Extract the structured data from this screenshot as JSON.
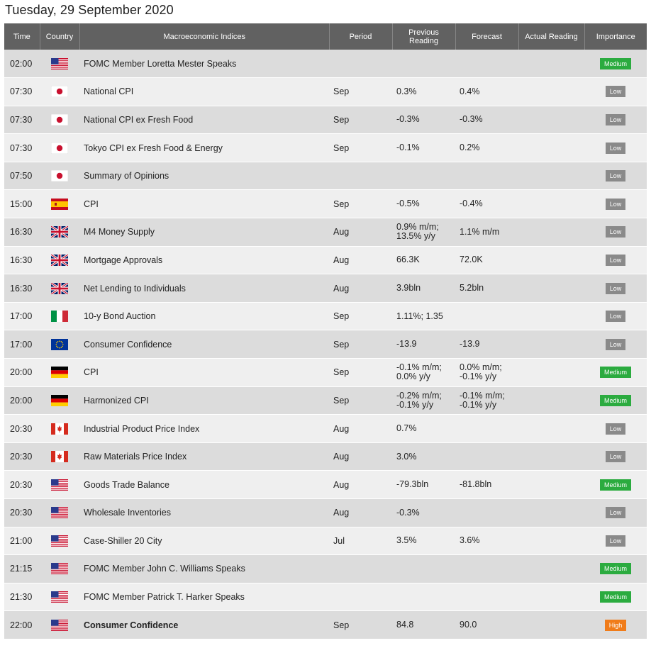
{
  "page": {
    "title": "Tuesday, 29 September 2020"
  },
  "table": {
    "headers": {
      "time": "Time",
      "country": "Country",
      "indices": "Macroeconomic Indices",
      "period": "Period",
      "previous_line1": "Previous",
      "previous_line2": "Reading",
      "forecast": "Forecast",
      "actual": "Actual Reading",
      "importance": "Importance"
    },
    "colors": {
      "Medium": "#2bab3f",
      "Low": "#8a8a8a",
      "High": "#f07c1a"
    },
    "rows": [
      {
        "time": "02:00",
        "flag": "us-flag-icon",
        "event": "FOMC Member Loretta Mester Speaks",
        "period": "",
        "prev1": "",
        "prev2": "",
        "fore1": "",
        "fore2": "",
        "actual": "",
        "importance": "Medium",
        "bold": false
      },
      {
        "time": "07:30",
        "flag": "jp-flag-icon",
        "event": "National CPI",
        "period": "Sep",
        "prev1": "0.3%",
        "prev2": "",
        "fore1": "0.4%",
        "fore2": "",
        "actual": "",
        "importance": "Low",
        "bold": false
      },
      {
        "time": "07:30",
        "flag": "jp-flag-icon",
        "event": "National CPI ex Fresh Food",
        "period": "Sep",
        "prev1": "-0.3%",
        "prev2": "",
        "fore1": "-0.3%",
        "fore2": "",
        "actual": "",
        "importance": "Low",
        "bold": false
      },
      {
        "time": "07:30",
        "flag": "jp-flag-icon",
        "event": "Tokyo CPI ex Fresh Food & Energy",
        "period": "Sep",
        "prev1": "-0.1%",
        "prev2": "",
        "fore1": "0.2%",
        "fore2": "",
        "actual": "",
        "importance": "Low",
        "bold": false
      },
      {
        "time": "07:50",
        "flag": "jp-flag-icon",
        "event": "Summary of Opinions",
        "period": "",
        "prev1": "",
        "prev2": "",
        "fore1": "",
        "fore2": "",
        "actual": "",
        "importance": "Low",
        "bold": false
      },
      {
        "time": "15:00",
        "flag": "es-flag-icon",
        "event": "CPI",
        "period": "Sep",
        "prev1": "-0.5%",
        "prev2": "",
        "fore1": "-0.4%",
        "fore2": "",
        "actual": "",
        "importance": "Low",
        "bold": false
      },
      {
        "time": "16:30",
        "flag": "gb-flag-icon",
        "event": "M4 Money Supply",
        "period": "Aug",
        "prev1": "0.9% m/m;",
        "prev2": "13.5% y/y",
        "fore1": "1.1% m/m",
        "fore2": "",
        "actual": "",
        "importance": "Low",
        "bold": false
      },
      {
        "time": "16:30",
        "flag": "gb-flag-icon",
        "event": "Mortgage Approvals",
        "period": "Aug",
        "prev1": "66.3K",
        "prev2": "",
        "fore1": "72.0K",
        "fore2": "",
        "actual": "",
        "importance": "Low",
        "bold": false
      },
      {
        "time": "16:30",
        "flag": "gb-flag-icon",
        "event": "Net Lending to Individuals",
        "period": "Aug",
        "prev1": "3.9bln",
        "prev2": "",
        "fore1": "5.2bln",
        "fore2": "",
        "actual": "",
        "importance": "Low",
        "bold": false
      },
      {
        "time": "17:00",
        "flag": "it-flag-icon",
        "event": "10-y Bond Auction",
        "period": "Sep",
        "prev1": "1.11%; 1.35",
        "prev2": "",
        "fore1": "",
        "fore2": "",
        "actual": "",
        "importance": "Low",
        "bold": false
      },
      {
        "time": "17:00",
        "flag": "eu-flag-icon",
        "event": "Consumer Confidence",
        "period": "Sep",
        "prev1": "-13.9",
        "prev2": "",
        "fore1": "-13.9",
        "fore2": "",
        "actual": "",
        "importance": "Low",
        "bold": false
      },
      {
        "time": "20:00",
        "flag": "de-flag-icon",
        "event": "CPI",
        "period": "Sep",
        "prev1": "-0.1% m/m;",
        "prev2": "0.0% y/y",
        "fore1": "0.0% m/m;",
        "fore2": "-0.1% y/y",
        "actual": "",
        "importance": "Medium",
        "bold": false
      },
      {
        "time": "20:00",
        "flag": "de-flag-icon",
        "event": "Harmonized CPI",
        "period": "Sep",
        "prev1": "-0.2% m/m;",
        "prev2": "-0.1% y/y",
        "fore1": "-0.1% m/m;",
        "fore2": "-0.1% y/y",
        "actual": "",
        "importance": "Medium",
        "bold": false
      },
      {
        "time": "20:30",
        "flag": "ca-flag-icon",
        "event": "Industrial Product Price Index",
        "period": "Aug",
        "prev1": "0.7%",
        "prev2": "",
        "fore1": "",
        "fore2": "",
        "actual": "",
        "importance": "Low",
        "bold": false
      },
      {
        "time": "20:30",
        "flag": "ca-flag-icon",
        "event": "Raw Materials Price Index",
        "period": "Aug",
        "prev1": "3.0%",
        "prev2": "",
        "fore1": "",
        "fore2": "",
        "actual": "",
        "importance": "Low",
        "bold": false
      },
      {
        "time": "20:30",
        "flag": "us-flag-icon",
        "event": "Goods Trade Balance",
        "period": "Aug",
        "prev1": "-79.3bln",
        "prev2": "",
        "fore1": "-81.8bln",
        "fore2": "",
        "actual": "",
        "importance": "Medium",
        "bold": false
      },
      {
        "time": "20:30",
        "flag": "us-flag-icon",
        "event": "Wholesale Inventories",
        "period": "Aug",
        "prev1": "-0.3%",
        "prev2": "",
        "fore1": "",
        "fore2": "",
        "actual": "",
        "importance": "Low",
        "bold": false
      },
      {
        "time": "21:00",
        "flag": "us-flag-icon",
        "event": "Case-Shiller 20 City",
        "period": "Jul",
        "prev1": "3.5%",
        "prev2": "",
        "fore1": "3.6%",
        "fore2": "",
        "actual": "",
        "importance": "Low",
        "bold": false
      },
      {
        "time": "21:15",
        "flag": "us-flag-icon",
        "event": "FOMC Member John C. Williams Speaks",
        "period": "",
        "prev1": "",
        "prev2": "",
        "fore1": "",
        "fore2": "",
        "actual": "",
        "importance": "Medium",
        "bold": false
      },
      {
        "time": "21:30",
        "flag": "us-flag-icon",
        "event": "FOMC Member Patrick T. Harker Speaks",
        "period": "",
        "prev1": "",
        "prev2": "",
        "fore1": "",
        "fore2": "",
        "actual": "",
        "importance": "Medium",
        "bold": false
      },
      {
        "time": "22:00",
        "flag": "us-flag-icon",
        "event": "Consumer Confidence",
        "period": "Sep",
        "prev1": "84.8",
        "prev2": "",
        "fore1": "90.0",
        "fore2": "",
        "actual": "",
        "importance": "High",
        "bold": true
      }
    ]
  }
}
